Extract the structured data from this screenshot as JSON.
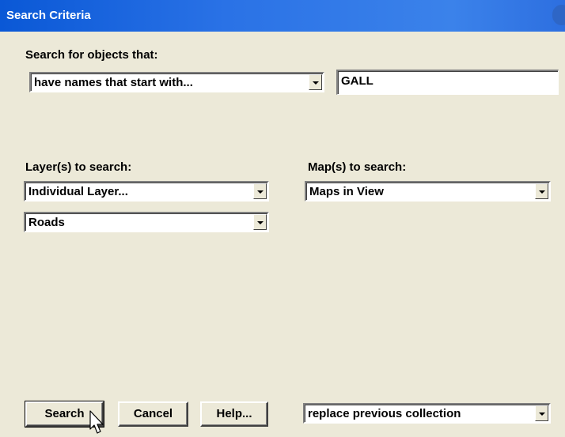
{
  "window": {
    "title": "Search Criteria"
  },
  "search_for": {
    "label": "Search for objects that:",
    "criteria_selected": "have names that start with...",
    "value": "GALL"
  },
  "layers": {
    "label": "Layer(s) to search:",
    "scope_selected": "Individual Layer...",
    "layer_selected": "Roads"
  },
  "maps": {
    "label": "Map(s) to search:",
    "selected": "Maps in View"
  },
  "buttons": {
    "search": "Search",
    "cancel": "Cancel",
    "help": "Help..."
  },
  "collection_mode": {
    "selected": "replace previous collection"
  }
}
